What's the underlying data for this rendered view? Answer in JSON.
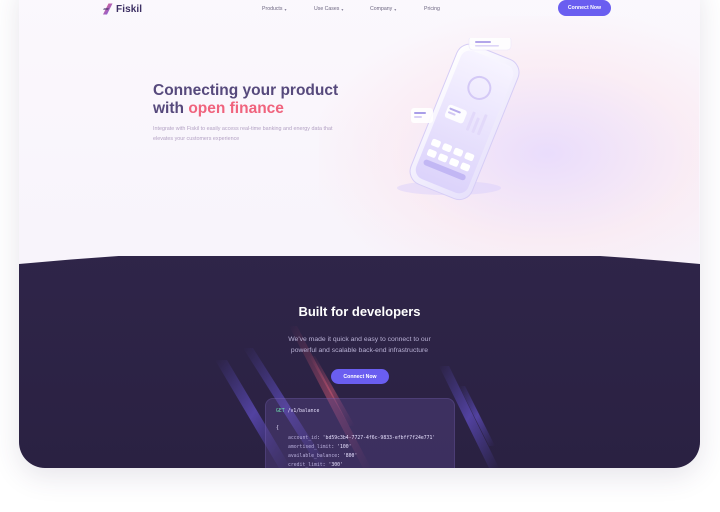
{
  "nav": {
    "brand": "Fiskil",
    "items": [
      {
        "label": "Products",
        "has_caret": true
      },
      {
        "label": "Use Cases",
        "has_caret": true
      },
      {
        "label": "Company",
        "has_caret": true
      },
      {
        "label": "Pricing",
        "has_caret": false
      }
    ],
    "cta": "Connect Now"
  },
  "hero": {
    "title_line1": "Connecting your product",
    "title_line2_prefix": "with ",
    "title_line2_accent": "open finance",
    "subtitle_line1": "Integrate with Fiskil to easily access real-time banking and energy data that",
    "subtitle_line2": "elevates your customers experience"
  },
  "developers": {
    "title": "Built for developers",
    "subtitle_line1": "We've made it quick and easy to connect to our",
    "subtitle_line2": "powerful and scalable back-end infrastructure",
    "cta": "Connect Now",
    "code": {
      "method": "GET",
      "path": "/v1/balance",
      "open_brace": "{",
      "lines": [
        {
          "key": "account_id",
          "value": "'bd59c3b4-7727-4f6c-9833-efbff7f24e771'"
        },
        {
          "key": "amortised_limit",
          "value": "'100'"
        },
        {
          "key": "available_balance",
          "value": "'800'"
        },
        {
          "key": "credit_limit",
          "value": "'300'"
        }
      ]
    }
  },
  "colors": {
    "brand_purple": "#6a5ef0",
    "accent_pink": "#f0637d",
    "dark_section": "#2c2244",
    "title_text": "#56497c"
  },
  "icons": [
    "logo-mark-icon",
    "chevron-down-icon"
  ]
}
